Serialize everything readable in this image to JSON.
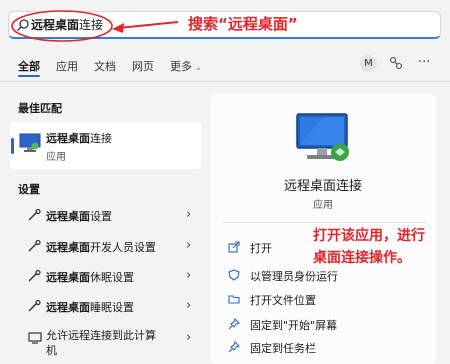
{
  "search": {
    "query_bold": "远程桌面",
    "query_rest": "连接",
    "annotation": "搜索“远程桌面”"
  },
  "tabs": [
    {
      "label": "全部"
    },
    {
      "label": "应用"
    },
    {
      "label": "文档"
    },
    {
      "label": "网页"
    },
    {
      "label": "更多"
    }
  ],
  "toolbar": {
    "avatar_letter": "M"
  },
  "best_match": {
    "section_label": "最佳匹配",
    "title_bold": "远程桌面",
    "title_rest": "连接",
    "subtitle": "应用"
  },
  "settings": {
    "section_label": "设置",
    "items": [
      {
        "bold": "远程桌面",
        "rest": "设置"
      },
      {
        "bold": "远程桌面",
        "rest": "开发人员设置"
      },
      {
        "bold": "远程桌面",
        "rest": "休眠设置"
      },
      {
        "bold": "远程桌面",
        "rest": "睡眠设置"
      },
      {
        "line1": "允许远程连接到此计算",
        "line2": "机"
      }
    ]
  },
  "detail": {
    "app_name": "远程桌面连接",
    "app_type": "应用",
    "annotation_line1": "打开该应用，进行",
    "annotation_line2": "桌面连接操作。",
    "actions": [
      {
        "label": "打开",
        "icon": "open-external-icon"
      },
      {
        "label": "以管理员身份运行",
        "icon": "shield-icon"
      },
      {
        "label": "打开文件位置",
        "icon": "folder-icon"
      },
      {
        "label": "固定到\"开始\"屏幕",
        "icon": "pin-icon"
      },
      {
        "label": "固定到任务栏",
        "icon": "pin-icon"
      }
    ]
  },
  "colors": {
    "accent": "#2a66c6",
    "annotation": "#e0262b"
  }
}
